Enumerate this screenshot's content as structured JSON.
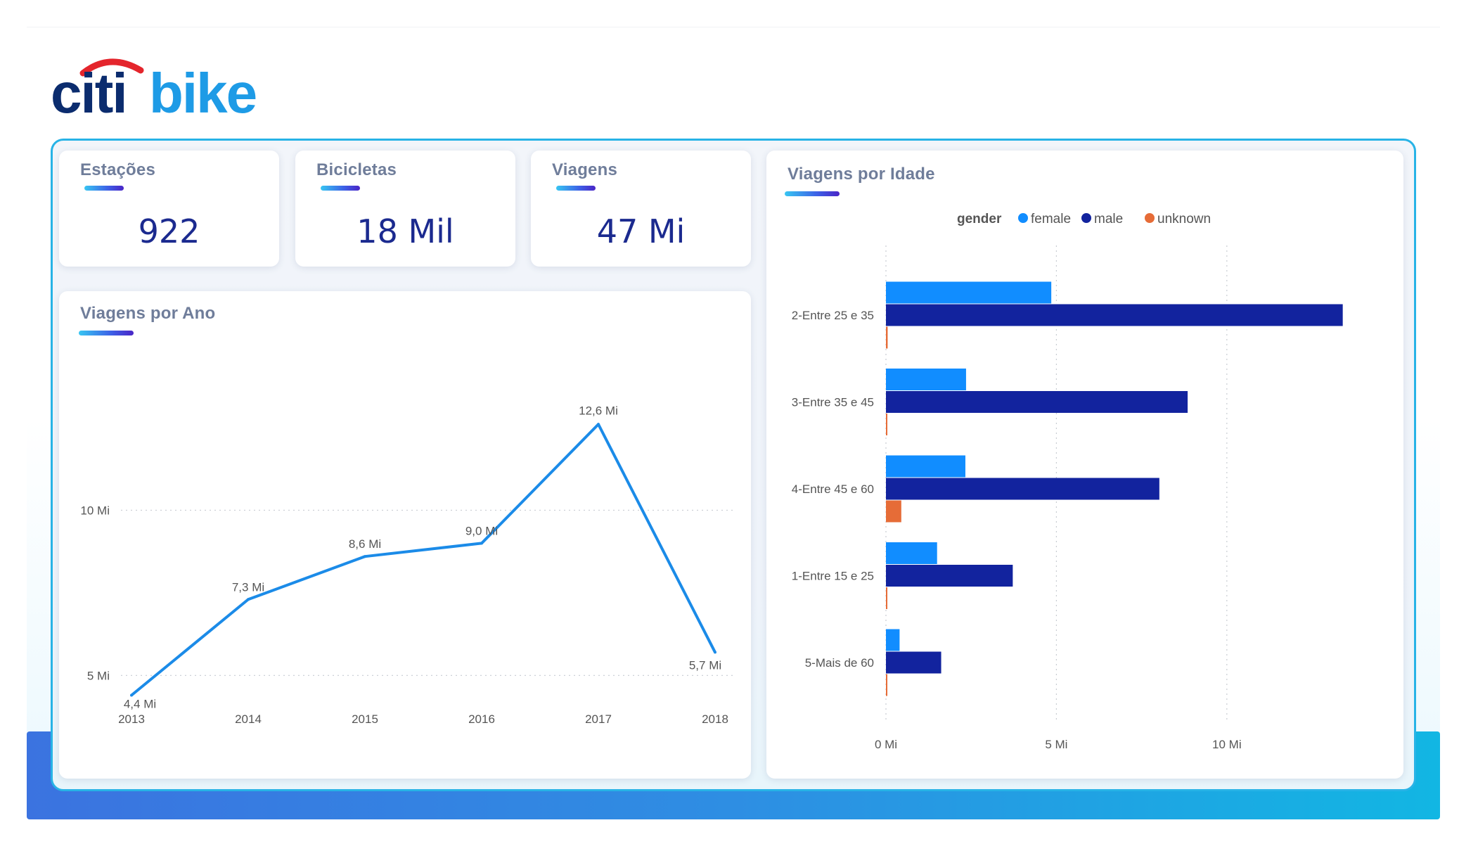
{
  "brand": {
    "logo_part1": "citi",
    "logo_part2": "bike"
  },
  "kpis": [
    {
      "title": "Estações",
      "value": "922"
    },
    {
      "title": "Bicicletas",
      "value": "18 Mil"
    },
    {
      "title": "Viagens",
      "value": "47 Mi"
    }
  ],
  "colors": {
    "female": "#118dff",
    "male": "#12239e",
    "unknown": "#e66c37",
    "line": "#1b8be8",
    "frame": "#28b3e6"
  },
  "chart_data": [
    {
      "type": "line",
      "title": "Viagens por Ano",
      "x": [
        "2013",
        "2014",
        "2015",
        "2016",
        "2017",
        "2018"
      ],
      "values": [
        4.4,
        7.3,
        8.6,
        9.0,
        12.6,
        5.7
      ],
      "data_labels": [
        "4,4 Mi",
        "7,3 Mi",
        "8,6 Mi",
        "9,0 Mi",
        "12,6 Mi",
        "5,7 Mi"
      ],
      "y_ticks": [
        {
          "value": 5,
          "label": "5 Mi"
        },
        {
          "value": 10,
          "label": "10 Mi"
        }
      ],
      "ylim": [
        3.9,
        14.5
      ],
      "grid": "horizontal dotted"
    },
    {
      "type": "bar",
      "orientation": "horizontal",
      "title": "Viagens por Idade",
      "legend_title": "gender",
      "legend_position": "top",
      "categories": [
        "2-Entre 25 e 35",
        "3-Entre 35 e 45",
        "4-Entre 45 e 60",
        "1-Entre 15 e 25",
        "5-Mais de 60"
      ],
      "series": [
        {
          "name": "female",
          "values": [
            4.85,
            2.35,
            2.33,
            1.5,
            0.4
          ]
        },
        {
          "name": "male",
          "values": [
            13.4,
            8.85,
            8.02,
            3.72,
            1.62
          ]
        },
        {
          "name": "unknown",
          "values": [
            0.05,
            0.03,
            0.45,
            0.03,
            0.03
          ]
        }
      ],
      "x_ticks": [
        {
          "value": 0,
          "label": "0 Mi"
        },
        {
          "value": 5,
          "label": "5 Mi"
        },
        {
          "value": 10,
          "label": "10 Mi"
        }
      ],
      "xlim": [
        0,
        14.5
      ],
      "grid": "vertical dotted"
    }
  ]
}
